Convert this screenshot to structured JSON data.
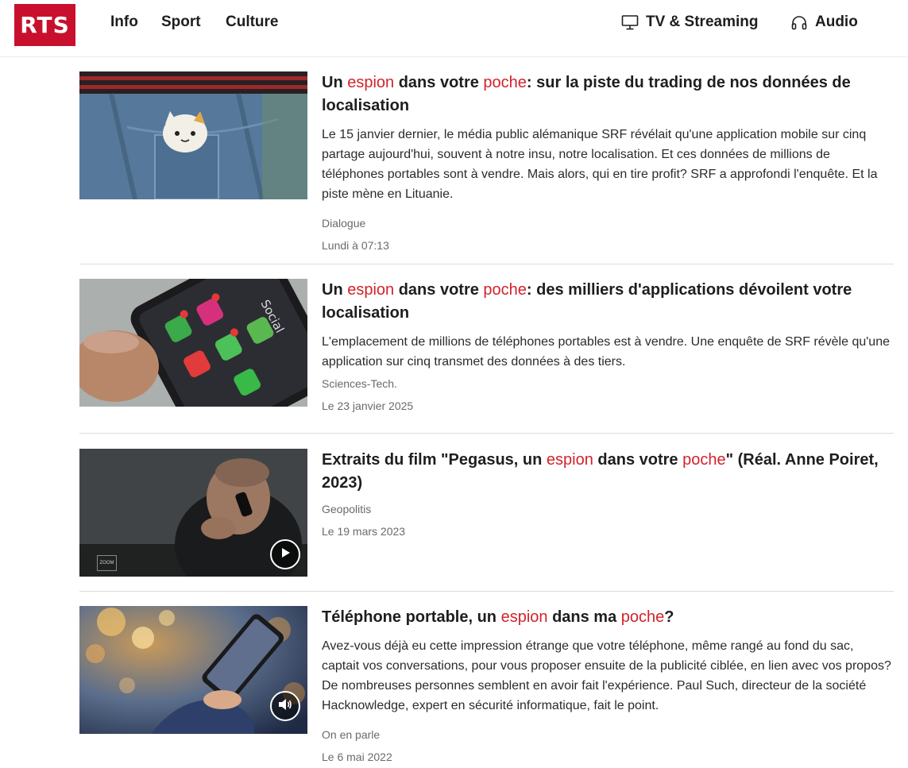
{
  "header": {
    "logo": "RTS",
    "nav": [
      "Info",
      "Sport",
      "Culture"
    ],
    "tv_streaming": "TV & Streaming",
    "audio": "Audio"
  },
  "articles": [
    {
      "title_parts": [
        "Un ",
        "espion",
        " dans votre ",
        "poche",
        ": sur la piste du trading de nos données de localisation"
      ],
      "summary": "Le 15 janvier dernier, le média public alémanique SRF révélait qu'une application mobile sur cinq partage aujourd'hui, souvent à notre insu, notre localisation. Et ces données de millions de téléphones portables sont à vendre. Mais alors, qui en tire profit? SRF a approfondi l'enquête. Et la piste mène en Lituanie.",
      "category": "Dialogue",
      "date": "Lundi à 07:13"
    },
    {
      "title_parts": [
        "Un ",
        "espion",
        " dans votre ",
        "poche",
        ": des milliers d'applications dévoilent votre localisation"
      ],
      "summary": "L'emplacement de millions de téléphones portables est à vendre. Une enquête de SRF révèle qu'une application sur cinq transmet des données à des tiers.",
      "category": "Sciences-Tech.",
      "date": "Le 23 janvier 2025",
      "thumb_label": "Social"
    },
    {
      "title_parts": [
        "Extraits du film \"Pegasus, un ",
        "espion",
        " dans votre ",
        "poche",
        "\" (Réal. Anne Poiret, 2023)"
      ],
      "summary": "",
      "category": "Geopolitis",
      "date": "Le 19 mars 2023",
      "thumb_label": "ZOOM"
    },
    {
      "title_parts": [
        "Téléphone portable, un ",
        "espion",
        " dans ma ",
        "poche",
        "?"
      ],
      "summary": "Avez-vous déjà eu cette impression étrange que votre téléphone, même rangé au fond du sac, captait vos conversations, pour vous proposer ensuite de la publicité ciblée, en lien avec vos propos? De nombreuses personnes semblent en avoir fait l'expérience. Paul Such, directeur de la société Hacknowledge, expert en sécurité informatique, fait le point.",
      "category": "On en parle",
      "date": "Le 6 mai 2022"
    }
  ],
  "colors": {
    "brand": "#c8102e",
    "highlight": "#d2232a",
    "meta_text": "#6a6a6a"
  },
  "icons": {
    "tv": "monitor-icon",
    "audio": "headphones-icon",
    "video": "play-icon",
    "sound": "speaker-icon"
  }
}
